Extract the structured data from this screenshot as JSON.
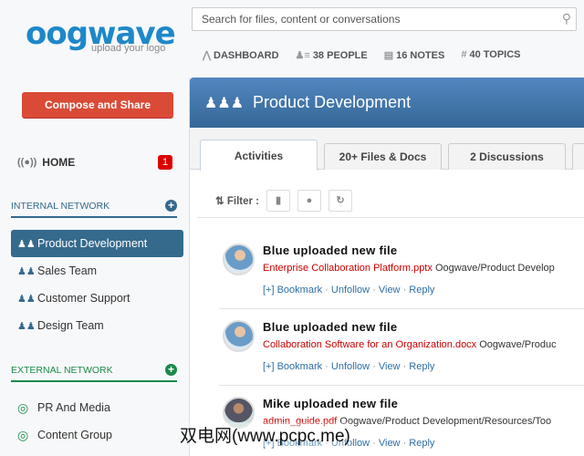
{
  "logo": {
    "name": "oogwave",
    "tagline": "upload your logo"
  },
  "search": {
    "placeholder": "Search for files, content or conversations"
  },
  "topnav": [
    {
      "icon": "chart-icon",
      "label": "DASHBOARD"
    },
    {
      "icon": "people-icon",
      "label": "38 PEOPLE"
    },
    {
      "icon": "notes-icon",
      "label": "16 NOTES"
    },
    {
      "icon": "hash-icon",
      "label": "40 TOPICS"
    }
  ],
  "sidebar": {
    "compose_label": "Compose and Share",
    "home": {
      "label": "HOME",
      "badge": "1"
    },
    "internal": {
      "title": "INTERNAL NETWORK",
      "color": "#356a8d",
      "items": [
        "Product Development",
        "Sales Team",
        "Customer Support",
        "Design Team"
      ]
    },
    "external": {
      "title": "EXTERNAL NETWORK",
      "color": "#1a8a4a",
      "items": [
        "PR And Media",
        "Content Group"
      ]
    }
  },
  "main": {
    "title": "Product Development",
    "tabs": [
      "Activities",
      "20+ Files & Docs",
      "2 Discussions",
      ""
    ],
    "filter_label": "Filter :",
    "feed": [
      {
        "title": "Blue uploaded new file",
        "file": "Enterprise Collaboration Platform.pptx",
        "path": "Oogwave/Product Develop"
      },
      {
        "title": "Blue uploaded new file",
        "file": "Collaboration Software for an Organization.docx",
        "path": "Oogwave/Produc"
      },
      {
        "title": "Mike uploaded new file",
        "file": "admin_guide.pdf",
        "path": "Oogwave/Product Development/Resources/Too"
      }
    ],
    "actions": {
      "bookmark": "[+] Bookmark",
      "unfollow": "Unfollow",
      "view": "View",
      "reply": "Reply",
      "sep": " · "
    }
  },
  "watermark": "双电网(www.pcpc.me)"
}
